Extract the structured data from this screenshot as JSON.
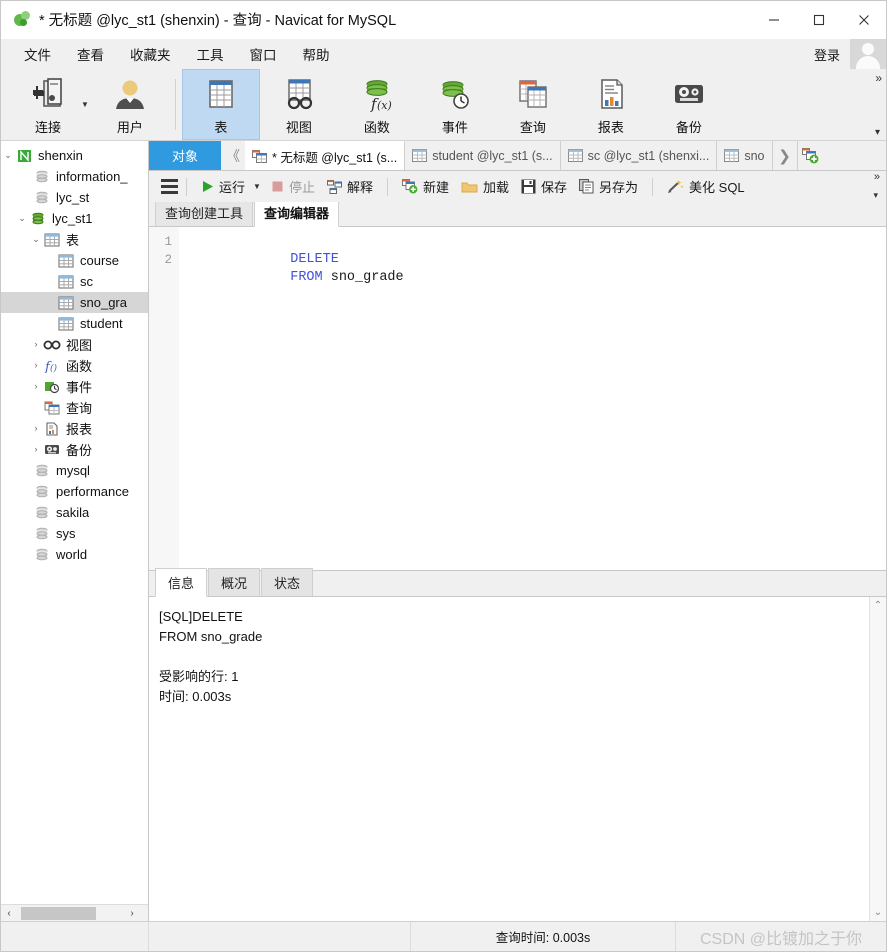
{
  "window": {
    "title": "* 无标题 @lyc_st1 (shenxin) - 查询 - Navicat for MySQL",
    "app_icon": "navicat-logo-icon",
    "minimize": "−",
    "maximize": "□",
    "close": "✕"
  },
  "menu": {
    "items": [
      {
        "label": "文件",
        "name": "menu-file"
      },
      {
        "label": "查看",
        "name": "menu-view"
      },
      {
        "label": "收藏夹",
        "name": "menu-favorites"
      },
      {
        "label": "工具",
        "name": "menu-tools"
      },
      {
        "label": "窗口",
        "name": "menu-window"
      },
      {
        "label": "帮助",
        "name": "menu-help"
      }
    ],
    "login_label": "登录"
  },
  "ribbon": {
    "expand_glyph": "»",
    "collapse_glyph": "▾",
    "items": [
      {
        "label": "连接",
        "icon": "connection-icon",
        "selected": false,
        "caret": true
      },
      {
        "label": "用户",
        "icon": "user-icon",
        "selected": false,
        "caret": false
      },
      {
        "label": "表",
        "icon": "table-icon",
        "selected": true,
        "caret": false
      },
      {
        "label": "视图",
        "icon": "view-icon",
        "selected": false,
        "caret": false
      },
      {
        "label": "函数",
        "icon": "function-icon",
        "selected": false,
        "caret": false
      },
      {
        "label": "事件",
        "icon": "event-icon",
        "selected": false,
        "caret": false
      },
      {
        "label": "查询",
        "icon": "query-icon",
        "selected": false,
        "caret": false
      },
      {
        "label": "报表",
        "icon": "report-icon",
        "selected": false,
        "caret": false
      },
      {
        "label": "备份",
        "icon": "backup-icon",
        "selected": false,
        "caret": false
      }
    ]
  },
  "sidebar": {
    "tree": [
      {
        "label": "shenxin",
        "indent": 0,
        "twist": "v",
        "icon": "connection-green-icon",
        "selected": false
      },
      {
        "label": "information_",
        "indent": 1,
        "twist": "",
        "icon": "database-gray-icon",
        "selected": false
      },
      {
        "label": "lyc_st",
        "indent": 1,
        "twist": "",
        "icon": "database-gray-icon",
        "selected": false
      },
      {
        "label": "lyc_st1",
        "indent": 1,
        "twist": "v",
        "icon": "database-green-icon",
        "selected": false
      },
      {
        "label": "表",
        "indent": 2,
        "twist": "v",
        "icon": "table-folder-icon",
        "selected": false
      },
      {
        "label": "course",
        "indent": 3,
        "twist": "",
        "icon": "table-item-icon",
        "selected": false
      },
      {
        "label": "sc",
        "indent": 3,
        "twist": "",
        "icon": "table-item-icon",
        "selected": false
      },
      {
        "label": "sno_gra",
        "indent": 3,
        "twist": "",
        "icon": "table-item-icon",
        "selected": true
      },
      {
        "label": "student",
        "indent": 3,
        "twist": "",
        "icon": "table-item-icon",
        "selected": false
      },
      {
        "label": "视图",
        "indent": 2,
        "twist": ">",
        "icon": "view-folder-icon",
        "selected": false
      },
      {
        "label": "函数",
        "indent": 2,
        "twist": ">",
        "icon": "function-folder-icon",
        "selected": false
      },
      {
        "label": "事件",
        "indent": 2,
        "twist": ">",
        "icon": "event-folder-icon",
        "selected": false
      },
      {
        "label": "查询",
        "indent": 2,
        "twist": "",
        "icon": "query-folder-icon",
        "selected": false
      },
      {
        "label": "报表",
        "indent": 2,
        "twist": ">",
        "icon": "report-folder-icon",
        "selected": false
      },
      {
        "label": "备份",
        "indent": 2,
        "twist": ">",
        "icon": "backup-folder-icon",
        "selected": false
      },
      {
        "label": "mysql",
        "indent": 1,
        "twist": "",
        "icon": "database-gray-icon",
        "selected": false
      },
      {
        "label": "performance",
        "indent": 1,
        "twist": "",
        "icon": "database-gray-icon",
        "selected": false
      },
      {
        "label": "sakila",
        "indent": 1,
        "twist": "",
        "icon": "database-gray-icon",
        "selected": false
      },
      {
        "label": "sys",
        "indent": 1,
        "twist": "",
        "icon": "database-gray-icon",
        "selected": false
      },
      {
        "label": "world",
        "indent": 1,
        "twist": "",
        "icon": "database-gray-icon",
        "selected": false
      }
    ],
    "scroll_left_glyph": "‹",
    "scroll_right_glyph": "›"
  },
  "tabstrip": {
    "object_tab": "对象",
    "nav_left_glyph": "《",
    "nav_right_glyph": "❯",
    "add_tab_icon": "new-query-icon",
    "tabs": [
      {
        "label": "* 无标题 @lyc_st1 (s...",
        "icon": "query-tab-icon",
        "active": true
      },
      {
        "label": "student @lyc_st1 (s...",
        "icon": "table-tab-icon",
        "active": false
      },
      {
        "label": "sc @lyc_st1 (shenxi...",
        "icon": "table-tab-icon",
        "active": false
      },
      {
        "label": "sno",
        "icon": "table-tab-icon",
        "active": false
      }
    ]
  },
  "query_toolbar": {
    "menu_icon": "hamburger-icon",
    "buttons": [
      {
        "label": "运行",
        "icon": "play-icon",
        "name": "run-button",
        "disabled": false,
        "caret": true
      },
      {
        "label": "停止",
        "icon": "stop-icon",
        "name": "stop-button",
        "disabled": true,
        "caret": false
      },
      {
        "label": "解释",
        "icon": "explain-icon",
        "name": "explain-button",
        "disabled": false,
        "caret": false
      },
      {
        "label": "新建",
        "icon": "new-icon",
        "name": "new-button",
        "disabled": false,
        "caret": false
      },
      {
        "label": "加载",
        "icon": "load-icon",
        "name": "load-button",
        "disabled": false,
        "caret": false
      },
      {
        "label": "保存",
        "icon": "save-icon",
        "name": "save-button",
        "disabled": false,
        "caret": false
      },
      {
        "label": "另存为",
        "icon": "save-as-icon",
        "name": "save-as-button",
        "disabled": false,
        "caret": false
      },
      {
        "label": "美化 SQL",
        "icon": "beautify-icon",
        "name": "beautify-button",
        "disabled": false,
        "caret": false
      }
    ],
    "expand_glyph": "»",
    "collapse_glyph": "▾"
  },
  "sub_tabs": [
    {
      "label": "查询创建工具",
      "active": false
    },
    {
      "label": "查询编辑器",
      "active": true
    }
  ],
  "editor": {
    "lines": [
      {
        "num": "1",
        "keyword": "DELETE",
        "rest": ""
      },
      {
        "num": "2",
        "keyword": "FROM",
        "rest": " sno_grade"
      }
    ]
  },
  "results": {
    "tabs": [
      {
        "label": "信息",
        "active": true
      },
      {
        "label": "概况",
        "active": false
      },
      {
        "label": "状态",
        "active": false
      }
    ],
    "message": "[SQL]DELETE\nFROM sno_grade\n\n受影响的行: 1\n时间: 0.003s",
    "scroll_up_glyph": "⌃",
    "scroll_down_glyph": "⌄"
  },
  "statusbar": {
    "left": "",
    "mid": "",
    "query_time": "查询时间: 0.003s",
    "watermark": "CSDN @比镀加之于你"
  }
}
